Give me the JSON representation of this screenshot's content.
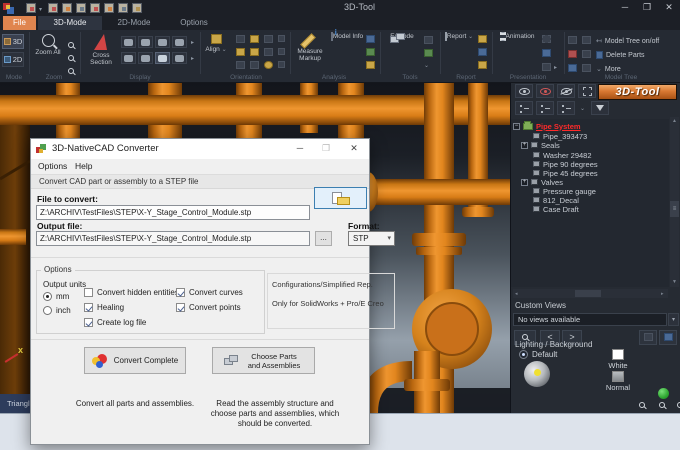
{
  "window": {
    "title": "3D-Tool",
    "controls": {
      "minimize": "─",
      "maximize": "❐",
      "close": "✕"
    }
  },
  "ribbon": {
    "tabs": [
      {
        "label": "File"
      },
      {
        "label": "3D-Mode"
      },
      {
        "label": "2D-Mode"
      },
      {
        "label": "Options"
      }
    ],
    "groups": {
      "mode": {
        "label": "Mode",
        "btn_3d": "3D",
        "btn_2d": "2D"
      },
      "zoom": {
        "label": "Zoom",
        "zoom_all": "Zoom All"
      },
      "display": {
        "label": "Display",
        "cross_section": "Cross Section"
      },
      "orientation": {
        "label": "Orientation",
        "align": "Align"
      },
      "analysis": {
        "label": "Analysis",
        "measure_markup": "Measure Markup",
        "model_info": "Model Info"
      },
      "tools": {
        "label": "Tools",
        "explode": "Explode"
      },
      "report": {
        "label": "Report",
        "report_btn": "Report"
      },
      "presentation": {
        "label": "Presentation",
        "animation": "Animation"
      },
      "model_tree": {
        "label": "Model Tree",
        "items": [
          {
            "label": "Model Tree on/off"
          },
          {
            "label": "Delete Parts"
          },
          {
            "label": "More"
          }
        ]
      }
    }
  },
  "right_panel": {
    "logo": "3D-Tool",
    "tree": {
      "root": "Pipe System",
      "items": [
        {
          "label": "Pipe_393473"
        },
        {
          "label": "Seals"
        },
        {
          "label": "Washer 29482"
        },
        {
          "label": "Pipe 90 degrees"
        },
        {
          "label": "Pipe 45 degrees"
        },
        {
          "label": "Valves"
        },
        {
          "label": "Pressure gauge"
        },
        {
          "label": "812_Decal"
        },
        {
          "label": "Case Draft"
        }
      ]
    },
    "custom_views": {
      "label": "Custom Views",
      "value": "No views available"
    },
    "nav": {
      "prev": "<",
      "next": ">"
    },
    "lighting": {
      "label": "Lighting / Background",
      "default_option": "Default",
      "white_label": "White",
      "normal_label": "Normal"
    }
  },
  "statusbar": {
    "triangles": "Triangles"
  },
  "dialog": {
    "title": "3D-NativeCAD Converter",
    "menu": [
      {
        "label": "Options"
      },
      {
        "label": "Help"
      }
    ],
    "info": "Convert CAD part or assembly to a STEP file",
    "file_label": "File to convert:",
    "file_value": "Z:\\ARCHIV\\TestFiles\\STEP\\X-Y_Stage_Control_Module.stp",
    "output_label": "Output file:",
    "output_value": "Z:\\ARCHIV\\TestFiles\\STEP\\X-Y_Stage_Control_Module.stp",
    "browse_dots": "...",
    "format_label": "Format:",
    "format_value": "STP",
    "options_label": "Options",
    "units_label": "Output units",
    "unit_mm": "mm",
    "unit_inch": "inch",
    "checks_left": [
      {
        "label": "Convert hidden entities",
        "checked": false
      },
      {
        "label": "Healing",
        "checked": true
      },
      {
        "label": "Create log file",
        "checked": true
      }
    ],
    "checks_right": [
      {
        "label": "Convert curves",
        "checked": true
      },
      {
        "label": "Convert points",
        "checked": true
      }
    ],
    "config_line1": "Configurations/Simplified Rep.",
    "config_line2": "Only for SolidWorks + Pro/E Creo",
    "btn_convert": "Convert Complete",
    "btn_choose": "Choose Parts and Assemblies",
    "desc_convert": "Convert all parts and assemblies.",
    "desc_choose": "Read the assembly structure and choose parts and assemblies, which should be converted."
  },
  "colors": {
    "file_tab_orange": "#E0854F",
    "pipe_orange": "#EF9630",
    "tree_root_red": "#FF2A2A",
    "focus_blue": "#3C7FB1",
    "ribbon_bg": "#252A33",
    "viewport_light": "#95A0AB"
  }
}
